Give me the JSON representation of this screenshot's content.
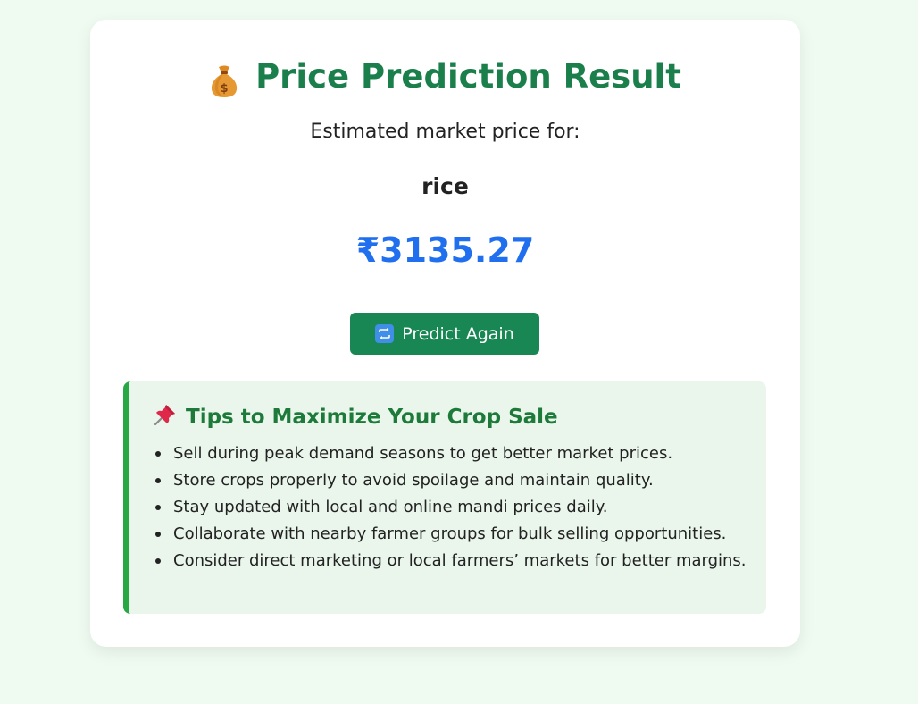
{
  "result": {
    "title": "Price Prediction Result",
    "title_icon": "money-bag-icon",
    "subtitle": "Estimated market price for:",
    "crop": "rice",
    "price": "₹3135.27",
    "predict_again_label": "Predict Again",
    "predict_again_icon": "repeat-arrows-icon"
  },
  "tips": {
    "heading": "Tips to Maximize Your Crop Sale",
    "heading_icon": "pushpin-icon",
    "items": [
      "Sell during peak demand seasons to get better market prices.",
      "Store crops properly to avoid spoilage and maintain quality.",
      "Stay updated with local and online mandi prices daily.",
      "Collaborate with nearby farmer groups for bulk selling opportunities.",
      "Consider direct marketing or local farmers’ markets for better margins."
    ]
  },
  "colors": {
    "page_background": "#effbf1",
    "title_green": "#1b7f4c",
    "price_blue": "#1f6fee",
    "button_green": "#198754",
    "tips_background": "#eaf6ec",
    "tips_border": "#28a745"
  }
}
